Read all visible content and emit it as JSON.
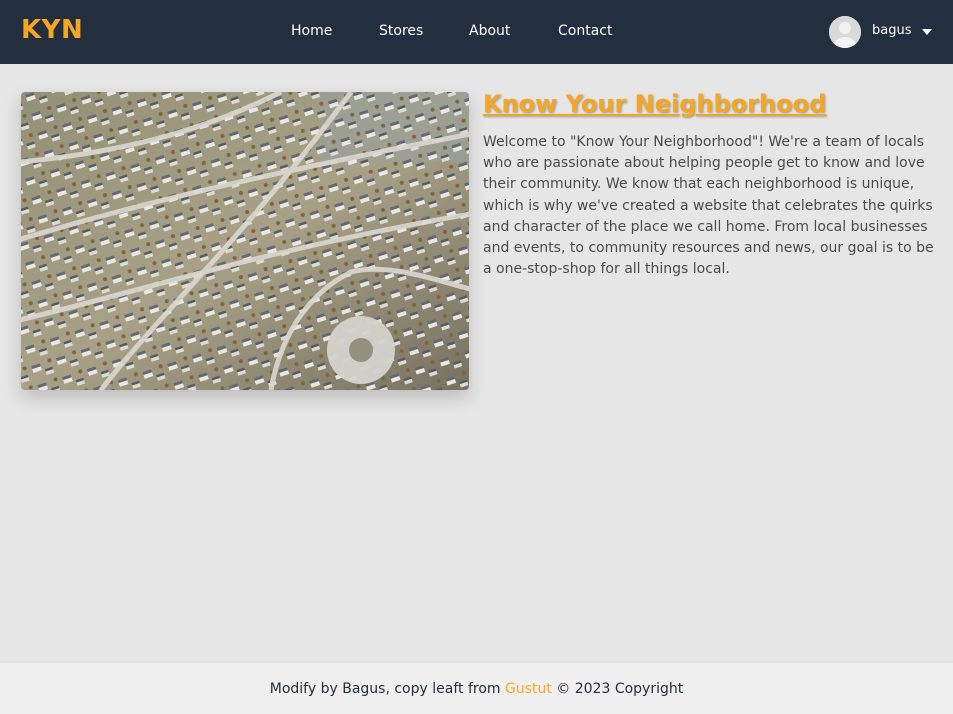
{
  "navbar": {
    "brand": "KYN",
    "links": [
      "Home",
      "Stores",
      "About",
      "Contact"
    ],
    "user": {
      "name": "bagus",
      "avatar_icon": "default-user-avatar-icon",
      "caret_icon": "caret-down-icon"
    }
  },
  "hero": {
    "image_alt": "aerial-suburb-photo",
    "title": "Know Your Neighborhood",
    "description": "Welcome to \"Know Your Neighborhood\"! We're a team of locals who are passionate about helping people get to know and love their community. We know that each neighborhood is unique, which is why we've created a website that celebrates the quirks and character of the place we call home. From local businesses and events, to community resources and news, our goal is to be a one-stop-shop for all things local."
  },
  "footer": {
    "prefix": "Modify by Bagus, copy leaft from ",
    "link_text": "Gustut",
    "suffix": " © 2023 Copyright"
  },
  "colors": {
    "navbar_bg": "#232f3e",
    "accent": "#f5a623",
    "page_bg": "#e6e6e6",
    "text": "#4a4a4a"
  }
}
